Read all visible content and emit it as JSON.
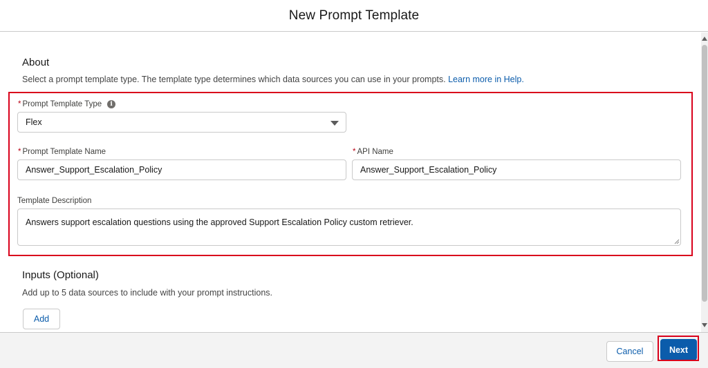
{
  "modal": {
    "title": "New Prompt Template"
  },
  "about": {
    "title": "About",
    "description": "Select a prompt template type. The template type determines which data sources you can use in your prompts. ",
    "help_link": "Learn more in Help."
  },
  "fields": {
    "template_type": {
      "label": "Prompt Template Type",
      "required_mark": "*",
      "value": "Flex"
    },
    "template_name": {
      "label": "Prompt Template Name",
      "required_mark": "*",
      "value": "Answer_Support_Escalation_Policy"
    },
    "api_name": {
      "label": "API Name",
      "required_mark": "*",
      "value": "Answer_Support_Escalation_Policy"
    },
    "description": {
      "label": "Template Description",
      "value": "Answers support escalation questions using the approved Support Escalation Policy custom retriever."
    }
  },
  "inputs": {
    "title": "Inputs (Optional)",
    "description": "Add up to 5 data sources to include with your prompt instructions.",
    "add_label": "Add"
  },
  "footer": {
    "cancel_label": "Cancel",
    "next_label": "Next"
  },
  "icons": {
    "info": "info-icon",
    "caret": "chevron-down-icon",
    "resize": "resize-grip-icon"
  },
  "colors": {
    "brand": "#0b5cab",
    "highlight": "#d9001b",
    "required": "#ba0517"
  }
}
